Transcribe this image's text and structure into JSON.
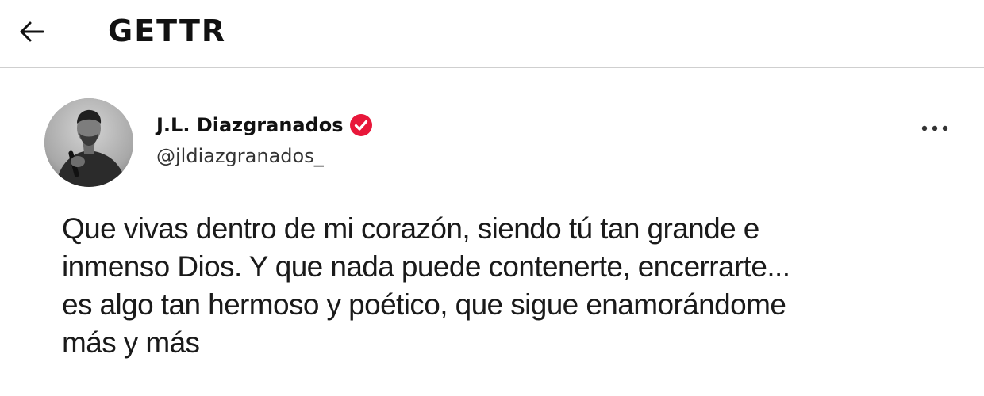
{
  "header": {
    "title": "GETTR",
    "back_icon": "arrow-left-icon"
  },
  "post": {
    "author": {
      "display_name": "J.L. Diazgranados",
      "handle": "@jldiazgranados_",
      "verified": true,
      "verified_color": "#e8173a",
      "avatar": "profile-photo-grayscale"
    },
    "more_icon": "more-horizontal-icon",
    "text": "Que vivas dentro de mi corazón, siendo tú tan grande e inmenso Dios. Y que nada puede contenerte, encerrarte... es algo tan hermoso y poético, que sigue enamorándome más y más"
  }
}
